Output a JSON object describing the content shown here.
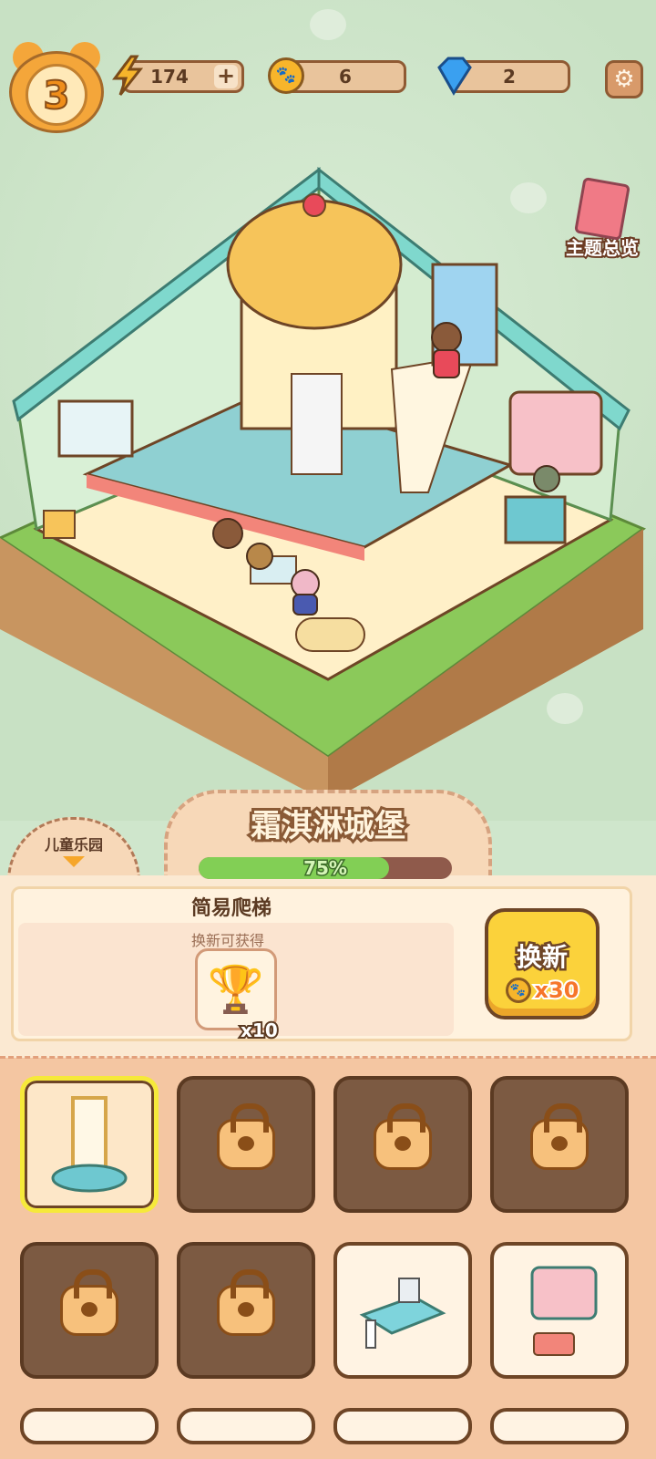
{
  "hud": {
    "level": "3",
    "energy": "174",
    "energy_add": "+",
    "coins": "6",
    "gems": "2"
  },
  "theme_overview": {
    "label": "主题总览"
  },
  "zone": {
    "label": "儿童乐园"
  },
  "building": {
    "title": "霜淇淋城堡",
    "progress_text": "75%",
    "progress_fraction": 0.75
  },
  "current_item": {
    "name": "简易爬梯",
    "reward_caption": "换新可获得",
    "reward_icon": "trophy-icon",
    "reward_count": "x10"
  },
  "renew_button": {
    "label": "换新",
    "cost": "x30",
    "currency_icon": "paw-coin-icon"
  },
  "items": [
    {
      "name": "ladder",
      "state": "selected"
    },
    {
      "name": "slide",
      "state": "locked"
    },
    {
      "name": "dome-tower",
      "state": "locked"
    },
    {
      "name": "sign-mat",
      "state": "locked"
    },
    {
      "name": "wall-board",
      "state": "locked"
    },
    {
      "name": "gift-stack",
      "state": "locked"
    },
    {
      "name": "desk",
      "state": "owned"
    },
    {
      "name": "shelf",
      "state": "owned"
    }
  ],
  "colors": {
    "accent": "#fbd23b",
    "progress": "#82cf55",
    "panel": "#f4c6a2",
    "scene": "#cfe6cc"
  }
}
